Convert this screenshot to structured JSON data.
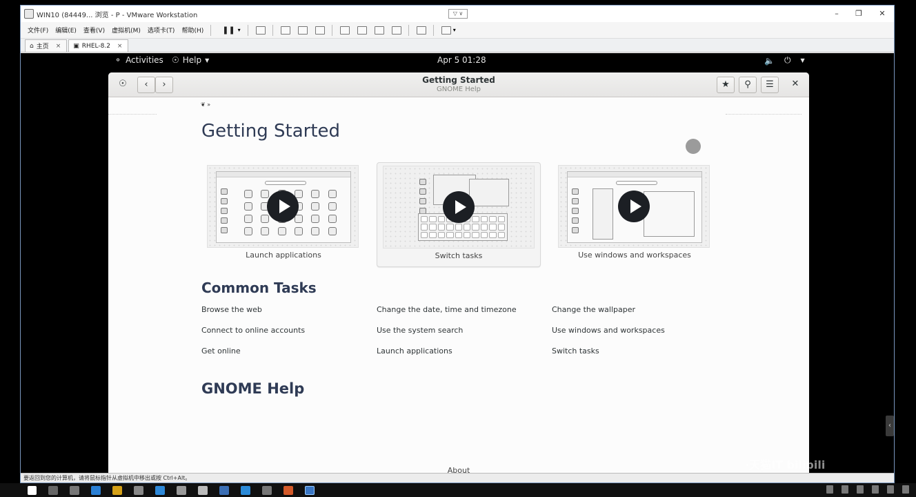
{
  "host": {
    "title": "WIN10 (84449...  浏览 - P - VMware Workstation",
    "title_dropdown": "▽ ∨",
    "menus": [
      "文件(F)",
      "编辑(E)",
      "查看(V)",
      "虚拟机(M)",
      "选项卡(T)",
      "帮助(H)"
    ],
    "tabs": [
      {
        "label": "主页"
      },
      {
        "label": "RHEL-8.2"
      }
    ],
    "status_text": "要返回到您的计算机，请将鼠标指针从虚拟机中移出或按 Ctrl+Alt。",
    "watermark": "·天猫IT bilibili"
  },
  "gnome": {
    "activities": "Activities",
    "app_menu": "Help",
    "clock": "Apr 5  01:28"
  },
  "help": {
    "window_title": "Getting Started",
    "window_subtitle": "GNOME Help",
    "page_heading": "Getting Started",
    "videos": [
      {
        "caption": "Launch applications"
      },
      {
        "caption": "Switch tasks"
      },
      {
        "caption": "Use windows and workspaces"
      }
    ],
    "common_heading": "Common Tasks",
    "tasks": [
      [
        "Browse the web",
        "Change the date, time and timezone",
        "Change the wallpaper"
      ],
      [
        "Connect to online accounts",
        "Use the system search",
        "Use windows and workspaces"
      ],
      [
        "Get online",
        "Launch applications",
        "Switch tasks"
      ]
    ],
    "gnome_help_heading": "GNOME Help",
    "about": "About"
  },
  "colors": {
    "heading": "#2f3b55",
    "play_button": "#1c1f24",
    "header_bg": "#e6e5e4"
  }
}
